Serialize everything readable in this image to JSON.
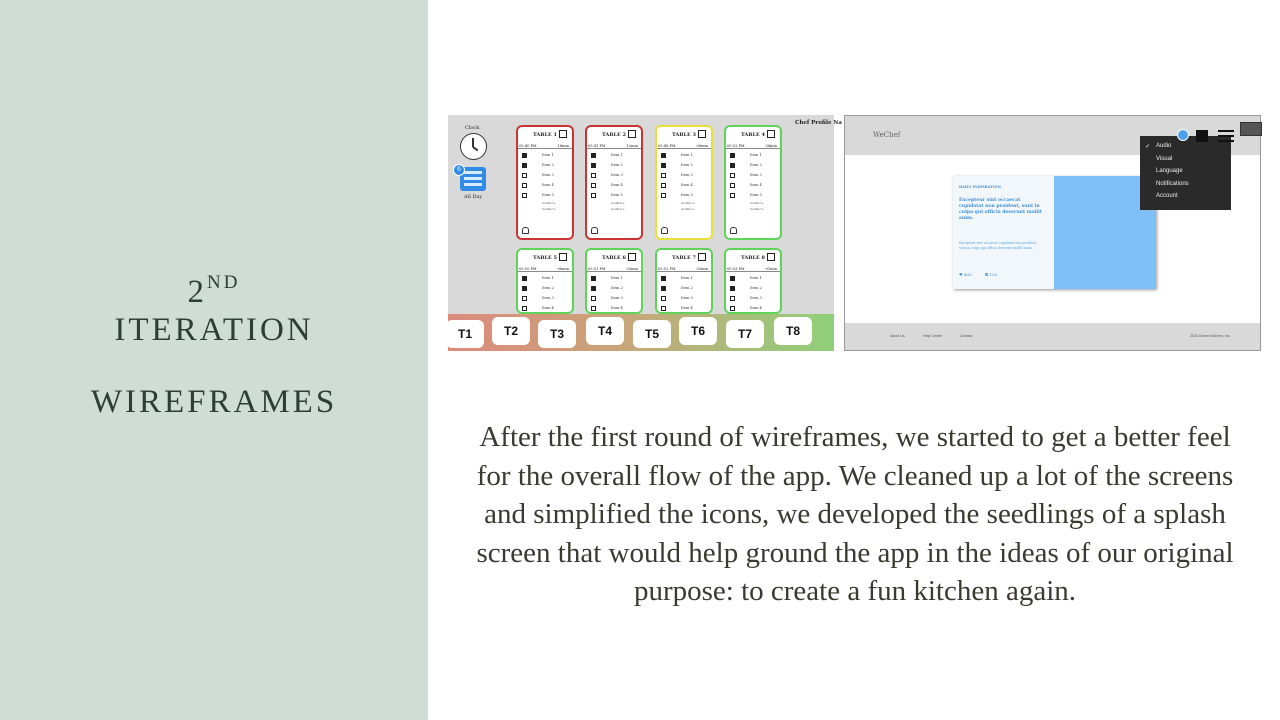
{
  "slide": {
    "title_line1": "2",
    "title_sup": "ND",
    "title_line2": "ITERATION",
    "title_line3": "WIREFRAMES",
    "body": "After the first round of wireframes, we started to get a better feel for the overall flow of the app. We cleaned up a lot of the screens and simplified the icons, we developed the seedlings of a splash screen that would help ground the app in the ideas of our original purpose: to create a fun kitchen again."
  },
  "kitchen": {
    "clock_label": "Clock",
    "allday_label": "All Day",
    "allday_badge": "6",
    "chef_label": "Chef Profile Na",
    "tables": [
      {
        "name": "TABLE 1",
        "time": "05:40 PM",
        "elapsed": "18min",
        "status": "red"
      },
      {
        "name": "TABLE 2",
        "time": "05:41 PM",
        "elapsed": "12min",
        "status": "red"
      },
      {
        "name": "TABLE 3",
        "time": "05:48 PM",
        "elapsed": "06min",
        "status": "yellow"
      },
      {
        "name": "TABLE 4",
        "time": "05:52 PM",
        "elapsed": "04min",
        "status": "green"
      },
      {
        "name": "TABLE 5",
        "time": "05:50 PM",
        "elapsed": "06min",
        "status": "green"
      },
      {
        "name": "TABLE 6",
        "time": "05:51 PM",
        "elapsed": "03min",
        "status": "green"
      },
      {
        "name": "TABLE 7",
        "time": "05:52 PM",
        "elapsed": "02min",
        "status": "green"
      },
      {
        "name": "TABLE 8",
        "time": "05:53 PM",
        "elapsed": "01min",
        "status": "green"
      }
    ],
    "items": [
      "Item 1",
      "Item 2",
      "Item 3",
      "Item 4",
      "Item 5"
    ],
    "modifier": "modifier a",
    "tabs": [
      "T1",
      "T2",
      "T3",
      "T4",
      "T5",
      "T6",
      "T7",
      "T8"
    ]
  },
  "wechef": {
    "logo": "WeChef",
    "menu": [
      "Audio",
      "Visual",
      "Language",
      "Notifications",
      "Account"
    ],
    "checked": "✓",
    "notif_count": "1",
    "inspiration_label": "DAILY INSPIRATION",
    "quote": "Excepteur sint occaecat cupidatat non proident, sunt in culpa qui officia deserunt mollit anim.",
    "small_text": "Excepteur sint occaecat cupidatat non proident, sunt in culpa qui officia deserunt mollit anim.",
    "likes": "♥ 400",
    "comments": "◘ 120",
    "footer": [
      "About Us",
      "Help Center",
      "Contact",
      "2021 Dream Kitchen, Inc."
    ]
  },
  "colors": {
    "sidebar": "#d0ddd5",
    "title": "#2d3f32",
    "red": "#cc3333",
    "yellow": "#e8e03a",
    "green": "#5fd35a",
    "accent_blue": "#2f8be6"
  }
}
